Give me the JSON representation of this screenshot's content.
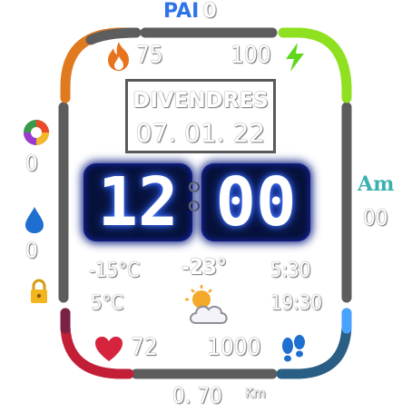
{
  "pai": {
    "label": "PAI",
    "value": "0"
  },
  "calories": {
    "value": "75",
    "icon": "flame-icon"
  },
  "battery": {
    "value": "100",
    "icon": "lightning-bolt-icon"
  },
  "date": {
    "weekday": "DIVENDRES",
    "date": "07. 01. 22"
  },
  "time": {
    "hours": "12",
    "minutes": "00",
    "separator": ":"
  },
  "ampm": {
    "label": "Am",
    "seconds": "00"
  },
  "left_widgets": {
    "stress_value": "0",
    "water_value": "0"
  },
  "weather": {
    "temp_low": "-15°C",
    "temp_high": "5°C",
    "temp_now": "-23°",
    "sunrise": "5:30",
    "sunset": "19:30",
    "icon": "partly-cloudy-icon"
  },
  "heart_rate": {
    "value": "72",
    "icon": "heart-icon"
  },
  "steps": {
    "value": "1000",
    "icon": "footprints-icon"
  },
  "distance": {
    "value": "0. 70",
    "unit": "Km"
  },
  "colors": {
    "ring_grey": "#5d5d5d",
    "ring_orange": "#e07a1e",
    "ring_green": "#8fe020",
    "ring_red": "#c21f37",
    "ring_blue": "#2e7fc4",
    "pai_blue": "#2d74e8",
    "am_teal": "#3ab0b0"
  }
}
